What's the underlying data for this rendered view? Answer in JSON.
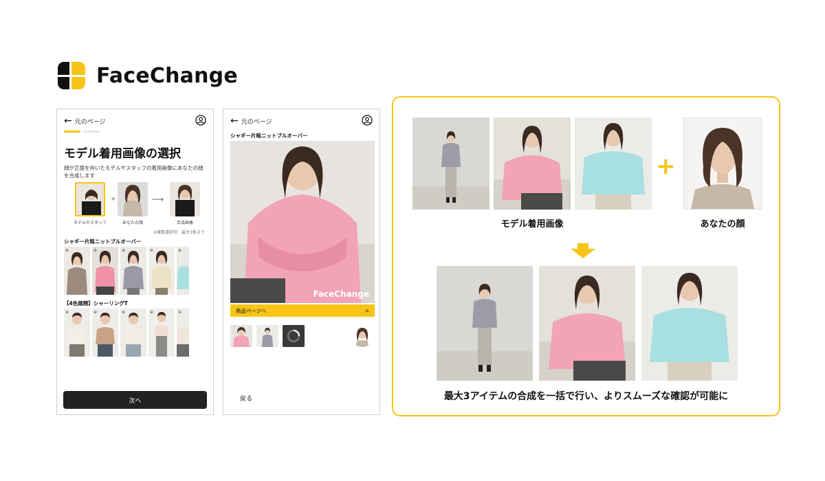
{
  "brand": {
    "name": "FaceChange",
    "accent": "#f7c417"
  },
  "screen1": {
    "back_label": "元のページ",
    "title": "モデル着用画像の選択",
    "description": "顔が正面を向いたモデルやスタッフの着用画像にあなたの顔を合成します",
    "flow": {
      "step1": "モデルやスタッフ",
      "step2": "あなたの顔",
      "step3": "合成画像",
      "plus": "+",
      "arrow": "⟶"
    },
    "note": "※複数選択可：最大3枚まで",
    "section1": "シャギー片畦ニットプルオーバー",
    "section2": "【4色展開】シャーリングT",
    "next_button": "次へ"
  },
  "screen2": {
    "back_label": "元のページ",
    "product_title": "シャギー片畦ニットプルオーバー",
    "watermark": "FaceChange",
    "product_link": "商品ページへ",
    "product_link_chevron": ">",
    "back_button": "戻る"
  },
  "right": {
    "caption_model": "モデル着用画像",
    "caption_face": "あなたの顔",
    "plus": "+",
    "bottom_caption": "最大3アイテムの合成を一括で行い、よりスムーズな確認が可能に"
  },
  "icons": {
    "back": "arrow-left-icon",
    "user": "user-circle-icon",
    "zoom": "zoom-icon",
    "chevron": "chevron-right-icon",
    "down": "down-arrow-icon"
  }
}
